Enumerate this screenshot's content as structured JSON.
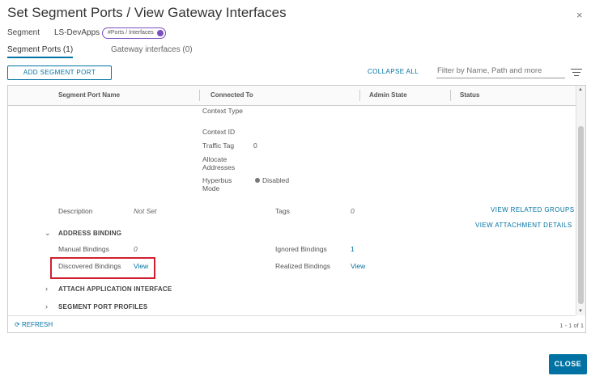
{
  "dialog": {
    "title": "Set Segment Ports / View Gateway Interfaces",
    "close_icon": "×"
  },
  "segment": {
    "label": "Segment",
    "name": "LS-DevApps",
    "badge": "#Ports / Interfaces"
  },
  "tabs": [
    {
      "label": "Segment Ports (1)",
      "active": true
    },
    {
      "label": "Gateway interfaces (0)",
      "active": false
    }
  ],
  "toolbar": {
    "add_label": "ADD SEGMENT PORT",
    "collapse_label": "COLLAPSE ALL",
    "filter_placeholder": "Filter by Name, Path and more"
  },
  "table": {
    "headers": [
      "Segment Port Name",
      "Connected To",
      "Admin State",
      "Status"
    ]
  },
  "details": {
    "context_type_label": "Context Type",
    "context_id_label": "Context ID",
    "traffic_tag_label": "Traffic Tag",
    "traffic_tag_value": "0",
    "allocate_label": "Allocate Addresses",
    "hyperbus_label": "Hyperbus Mode",
    "hyperbus_value": "Disabled",
    "description_label": "Description",
    "description_value": "Not Set",
    "tags_label": "Tags",
    "tags_value": "0",
    "view_groups": "VIEW RELATED GROUPS",
    "view_attach": "VIEW ATTACHMENT DETAILS"
  },
  "address_binding": {
    "title": "ADDRESS BINDING",
    "manual_label": "Manual Bindings",
    "manual_value": "0",
    "ignored_label": "Ignored Bindings",
    "ignored_value": "1",
    "discovered_label": "Discovered Bindings",
    "discovered_value": "View",
    "realized_label": "Realized Bindings",
    "realized_value": "View"
  },
  "sections": {
    "attach_app": "ATTACH APPLICATION INTERFACE",
    "port_profiles": "SEGMENT PORT PROFILES"
  },
  "footer": {
    "refresh_label": "REFRESH",
    "pagination": "1 - 1 of 1"
  },
  "actions": {
    "close_label": "CLOSE"
  },
  "colors": {
    "accent": "#0072a3",
    "badge": "#7b4fbf",
    "highlight": "#d0202f"
  }
}
